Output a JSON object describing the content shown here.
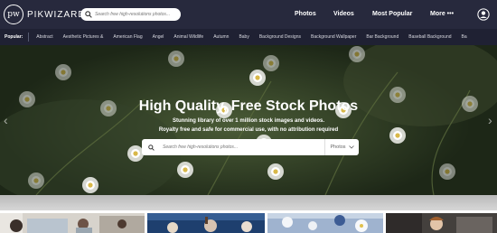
{
  "header": {
    "logo_mark": "pw",
    "logo_text": "PIKWIZARD",
    "search_placeholder": "Search free high-resolutions photos...",
    "nav": [
      "Photos",
      "Videos",
      "Most Popular",
      "More •••"
    ]
  },
  "categories": {
    "label": "Popular:",
    "items": [
      "Abstract",
      "Aesthetic Pictures &",
      "American Flag",
      "Angel",
      "Animal Wildlife",
      "Autumn",
      "Baby",
      "Background Designs",
      "Background Wallpaper",
      "Bar Background",
      "Baseball Background",
      "Ba"
    ]
  },
  "hero": {
    "title": "High Quality, Free Stock Photos",
    "subtitle_1": "Stunning library of over 1 million stock images and videos.",
    "subtitle_2": "Royalty free and safe for commercial use, with no attribution required",
    "search_placeholder": "Search free high-resolutions photos...",
    "filter_label": "Photos",
    "left_arrow": "‹",
    "right_arrow": "›"
  },
  "colors": {
    "header_bg": "#27293d",
    "category_bg": "#1f2133"
  }
}
